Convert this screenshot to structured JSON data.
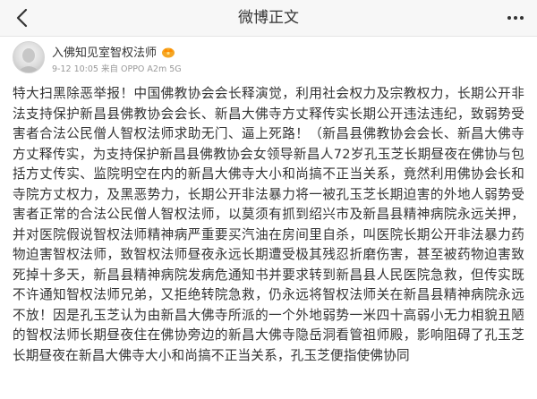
{
  "nav": {
    "title": "微博正文",
    "back_icon": "chevron-left-icon",
    "more_icon": "more-dots-icon"
  },
  "author": {
    "name": "入佛知见室智权法师",
    "timestamp": "9-12 10:05",
    "device": "来自 OPPO A2m 5G",
    "meta_line": "9-12 10:05 来自 OPPO A2m 5G",
    "badge_icon": "vip-crown-icon",
    "badge_color": "#f5a623"
  },
  "post": {
    "text": "特大扫黑除恶举报！中国佛教协会会长释演觉，利用社会权力及宗教权力，长期公开非法支持保护新昌县佛教协会会长、新昌大佛寺方丈释传实长期公开违法违纪，致弱势受害者合法公民僧人智权法师求助无门、逼上死路！（新昌县佛教协会会长、新昌大佛寺方丈释传实，为支持保护新昌县佛教协会女领导新昌人72岁孔玉芝长期昼夜在佛协与包括方丈传实、监院明空在内的新昌大佛寺大小和尚搞不正当关系，竟然利用佛协会长和寺院方丈权力，及黑恶势力，长期公开非法暴力将一被孔玉芝长期迫害的外地人弱势受害者正常的合法公民僧人智权法师，以莫须有抓到绍兴市及新昌县精神病院永远关押，并对医院假说智权法师精神病严重要买汽油在房间里自杀，叫医院长期公开非法暴力药物迫害智权法师，致智权法师昼夜永远长期遭受极其残忍折磨伤害，甚至被药物迫害致死掉十多天，新昌县精神病院发病危通知书并要求转到新昌县人民医院急救，但传实既不许通知智权法师兄弟，又拒绝转院急救，仍永远将智权法师关在新昌县精神病院永远不放！因是孔玉芝认为由新昌大佛寺所派的一个外地弱势一米四十高弱小无力相貌丑陋的智权法师长期昼夜住在佛协旁边的新昌大佛寺隐岳洞看管祖师殿，影响阻碍了孔玉芝长期昼夜在新昌大佛寺大小和尚搞不正当关系，孔玉芝便指使佛协同"
  },
  "colors": {
    "text": "#333333",
    "meta": "#999999",
    "navbar_bg": "#f7f7f7"
  }
}
